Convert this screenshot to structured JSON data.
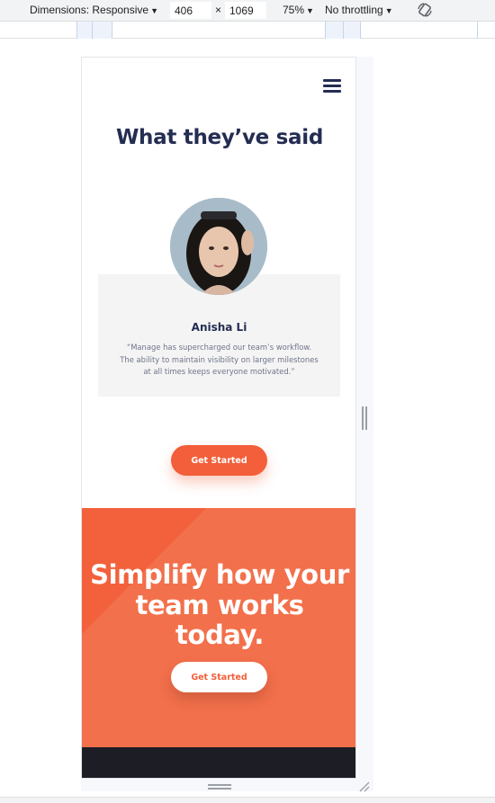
{
  "devtools": {
    "dimensions_label": "Dimensions: Responsive",
    "width_value": "406",
    "times_symbol": "×",
    "height_value": "1069",
    "zoom_label": "75%",
    "throttling_label": "No throttling",
    "caret": "▼"
  },
  "page": {
    "testimonial_heading": "What they’ve said",
    "testimonial": {
      "name": "Anisha Li",
      "quote": "“Manage has supercharged our team’s workflow. The ability to maintain visibility on larger milestones at all times keeps everyone motivated.”"
    },
    "cta_primary_label": "Get Started",
    "banner": {
      "title_line1": "Simplify how your",
      "title_line2": "team works",
      "title_line3": "today.",
      "cta_label": "Get Started"
    }
  },
  "colors": {
    "navy": "#242d52",
    "brand_orange": "#f25f3a",
    "banner_orange": "#f2704b",
    "footer_dark": "#1d1e25"
  },
  "icons": [
    "chevron-down-icon",
    "rotate-device-icon",
    "hamburger-menu-icon"
  ]
}
